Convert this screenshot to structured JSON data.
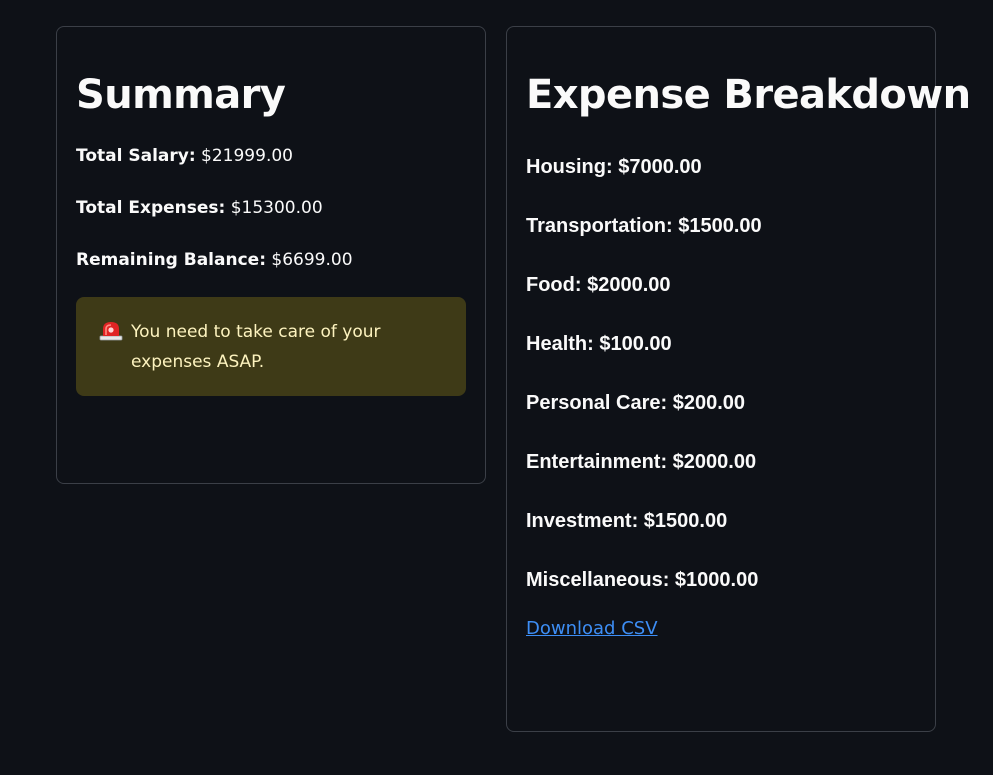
{
  "summary": {
    "title": "Summary",
    "lines": [
      {
        "label": "Total Salary:",
        "value": "$21999.00"
      },
      {
        "label": "Total Expenses:",
        "value": "$15300.00"
      },
      {
        "label": "Remaining Balance:",
        "value": "$6699.00"
      }
    ],
    "alert": {
      "icon": "siren-icon",
      "text": "You need to take care of your expenses ASAP.",
      "background": "#3e3a17",
      "text_color": "#fdf3bf"
    }
  },
  "breakdown": {
    "title": "Expense Breakdown",
    "items": [
      "Housing: $7000.00",
      "Transportation: $1500.00",
      "Food: $2000.00",
      "Health: $100.00",
      "Personal Care: $200.00",
      "Entertainment: $2000.00",
      "Investment: $1500.00",
      "Miscellaneous: $1000.00"
    ],
    "download_label": "Download CSV"
  },
  "colors": {
    "background": "#0e1117",
    "card_border": "#3b3f47",
    "link": "#3d8ef5",
    "text": "#fafafa"
  }
}
